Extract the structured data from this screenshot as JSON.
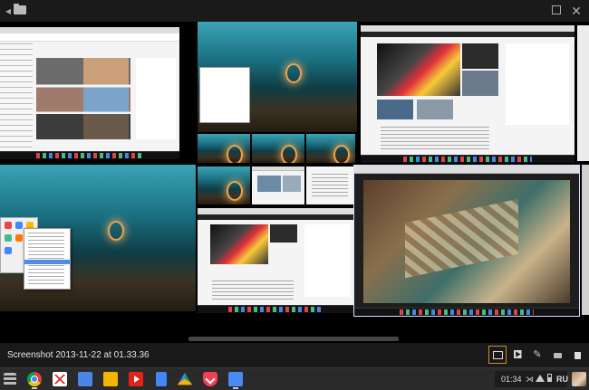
{
  "window": {
    "title_icons": {
      "back": "back-arrow-icon",
      "folder": "folder-icon",
      "maximize": "maximize-icon",
      "close": "close-icon"
    },
    "close_glyph": "✕",
    "back_glyph": "◂"
  },
  "viewer": {
    "caption": "Screenshot 2013-11-22 at 01.33.36",
    "tools": [
      {
        "name": "gallery-mode",
        "icon": "image-icon",
        "active": true
      },
      {
        "name": "slideshow",
        "icon": "slideshow-icon",
        "active": false
      },
      {
        "name": "edit",
        "icon": "pencil-icon",
        "active": false
      },
      {
        "name": "print",
        "icon": "print-icon",
        "active": false
      },
      {
        "name": "delete",
        "icon": "trash-icon",
        "active": false
      }
    ],
    "edit_glyph": "✎"
  },
  "shelf": {
    "apps": [
      "app-launcher",
      "chrome",
      "gmail",
      "calendar",
      "keep",
      "youtube",
      "docs",
      "drive",
      "pocket",
      "files"
    ],
    "clock": "01:34",
    "language": "RU",
    "mute_glyph": "⋊"
  },
  "colors": {
    "accent_active": "#d08a2a",
    "bottombar": "#191919",
    "shelf": "#2a2a2a"
  }
}
